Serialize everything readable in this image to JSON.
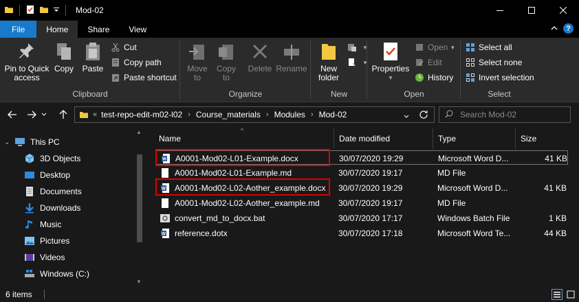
{
  "window": {
    "title": "Mod-02",
    "controls": [
      "minimize",
      "maximize",
      "close"
    ]
  },
  "ribbon_tabs": [
    {
      "label": "File"
    },
    {
      "label": "Home"
    },
    {
      "label": "Share"
    },
    {
      "label": "View"
    }
  ],
  "ribbon": {
    "clipboard": {
      "label": "Clipboard",
      "pin": "Pin to Quick access",
      "copy": "Copy",
      "paste": "Paste",
      "cut": "Cut",
      "copy_path": "Copy path",
      "paste_shortcut": "Paste shortcut"
    },
    "organize": {
      "label": "Organize",
      "move_to": "Move to",
      "copy_to": "Copy to",
      "delete": "Delete",
      "rename": "Rename"
    },
    "new": {
      "label": "New",
      "new_folder": "New folder"
    },
    "open": {
      "label": "Open",
      "properties": "Properties",
      "open": "Open",
      "edit": "Edit",
      "history": "History"
    },
    "select": {
      "label": "Select",
      "select_all": "Select all",
      "select_none": "Select none",
      "invert_selection": "Invert selection"
    }
  },
  "address": {
    "overflow": "«",
    "crumbs": [
      "test-repo-edit-m02-l02",
      "Course_materials",
      "Modules",
      "Mod-02"
    ]
  },
  "search": {
    "placeholder": "Search Mod-02"
  },
  "navpane": {
    "items": [
      {
        "label": "This PC",
        "icon": "computer-icon"
      },
      {
        "label": "3D Objects",
        "icon": "cube-icon"
      },
      {
        "label": "Desktop",
        "icon": "desktop-icon"
      },
      {
        "label": "Documents",
        "icon": "documents-icon"
      },
      {
        "label": "Downloads",
        "icon": "download-icon"
      },
      {
        "label": "Music",
        "icon": "music-icon"
      },
      {
        "label": "Pictures",
        "icon": "pictures-icon"
      },
      {
        "label": "Videos",
        "icon": "video-icon"
      },
      {
        "label": "Windows (C:)",
        "icon": "drive-icon"
      }
    ]
  },
  "columns": {
    "name": "Name",
    "date": "Date modified",
    "type": "Type",
    "size": "Size"
  },
  "files": [
    {
      "name": "A0001-Mod02-L01-Example.docx",
      "date": "30/07/2020 19:29",
      "type": "Microsoft Word D...",
      "size": "41 KB",
      "icon": "word-doc-icon",
      "highlighted": true,
      "selected": true
    },
    {
      "name": "A0001-Mod02-L01-Example.md",
      "date": "30/07/2020 19:17",
      "type": "MD File",
      "size": "",
      "icon": "text-file-icon",
      "highlighted": false,
      "selected": false
    },
    {
      "name": "A0001-Mod02-L02-Aother_example.docx",
      "date": "30/07/2020 19:29",
      "type": "Microsoft Word D...",
      "size": "41 KB",
      "icon": "word-doc-icon",
      "highlighted": true,
      "selected": false
    },
    {
      "name": "A0001-Mod02-L02-Aother_example.md",
      "date": "30/07/2020 19:17",
      "type": "MD File",
      "size": "",
      "icon": "text-file-icon",
      "highlighted": false,
      "selected": false
    },
    {
      "name": "convert_md_to_docx.bat",
      "date": "30/07/2020 17:17",
      "type": "Windows Batch File",
      "size": "1 KB",
      "icon": "batch-file-icon",
      "highlighted": false,
      "selected": false
    },
    {
      "name": "reference.dotx",
      "date": "30/07/2020 17:18",
      "type": "Microsoft Word Te...",
      "size": "44 KB",
      "icon": "word-template-icon",
      "highlighted": false,
      "selected": false
    }
  ],
  "status": {
    "items": "6 items"
  },
  "colors": {
    "accent": "#1979ca",
    "background": "#191919",
    "ribbon": "#2b2b2b",
    "highlight_box": "#e00000"
  }
}
